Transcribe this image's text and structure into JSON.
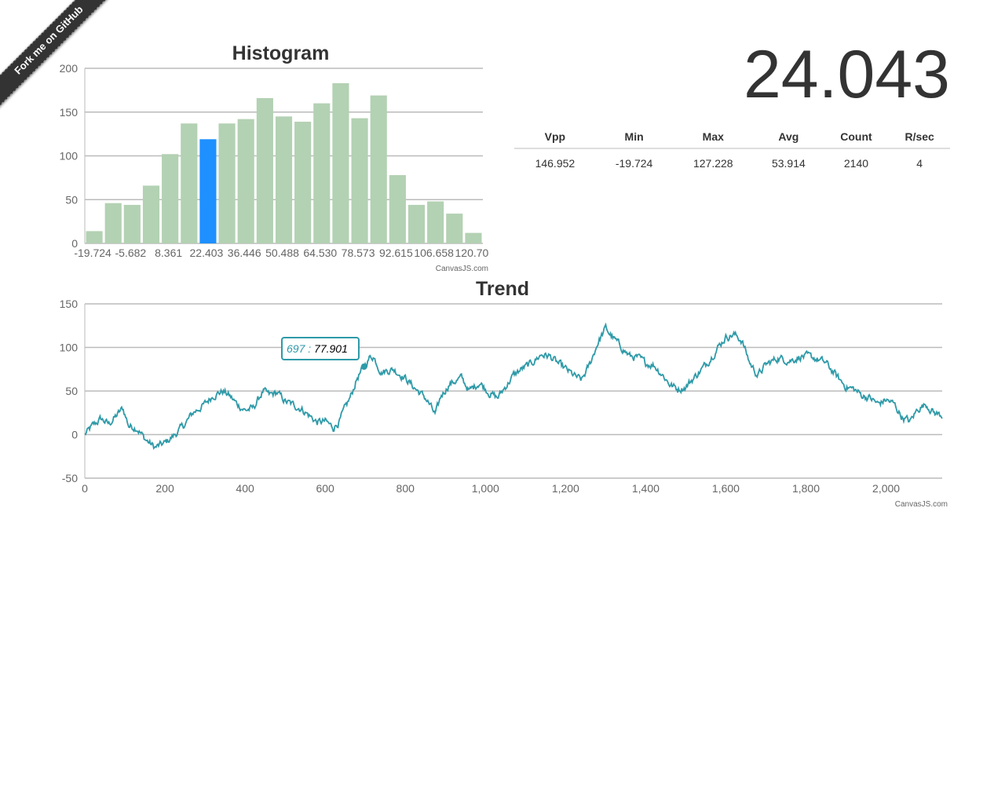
{
  "ribbon": {
    "label": "Fork me on GitHub"
  },
  "current_value": "24.043",
  "stats": {
    "headers": [
      "Vpp",
      "Min",
      "Max",
      "Avg",
      "Count",
      "R/sec"
    ],
    "values": [
      "146.952",
      "-19.724",
      "127.228",
      "53.914",
      "2140",
      "4"
    ]
  },
  "tooltip": {
    "x_label": "697 :",
    "y_value": "77.901"
  },
  "colors": {
    "bar": "#b3d1b3",
    "bar_highlight": "#1e90ff",
    "line": "#2e9aa8",
    "grid": "#bbbbbb"
  },
  "chart_data": [
    {
      "type": "bar",
      "title": "Histogram",
      "credit": "CanvasJS.com",
      "ylim": [
        0,
        200
      ],
      "yticks": [
        0,
        50,
        100,
        150,
        200
      ],
      "xtick_labels": [
        "-19.724",
        "-5.682",
        "8.361",
        "22.403",
        "36.446",
        "50.488",
        "64.530",
        "78.573",
        "92.615",
        "106.658",
        "120.70"
      ],
      "values": [
        14,
        46,
        44,
        66,
        102,
        137,
        119,
        137,
        142,
        166,
        145,
        139,
        160,
        183,
        143,
        169,
        78,
        44,
        48,
        34,
        12
      ],
      "highlight_index": 6,
      "grid": true
    },
    {
      "type": "line",
      "title": "Trend",
      "credit": "CanvasJS.com",
      "xlim": [
        0,
        2140
      ],
      "ylim": [
        -50,
        150
      ],
      "xticks": [
        0,
        200,
        400,
        600,
        800,
        1000,
        1200,
        1400,
        1600,
        1800,
        2000
      ],
      "xtick_labels": [
        "0",
        "200",
        "400",
        "600",
        "800",
        "1,000",
        "1,200",
        "1,400",
        "1,600",
        "1,800",
        "2,000"
      ],
      "yticks": [
        -50,
        0,
        50,
        100,
        150
      ],
      "highlight_point": [
        697,
        77.901
      ],
      "grid": true,
      "anchors": [
        [
          0,
          0
        ],
        [
          20,
          10
        ],
        [
          40,
          18
        ],
        [
          60,
          12
        ],
        [
          80,
          22
        ],
        [
          95,
          30
        ],
        [
          110,
          10
        ],
        [
          130,
          8
        ],
        [
          150,
          -5
        ],
        [
          175,
          -15
        ],
        [
          200,
          -10
        ],
        [
          225,
          0
        ],
        [
          250,
          12
        ],
        [
          270,
          25
        ],
        [
          300,
          35
        ],
        [
          320,
          45
        ],
        [
          345,
          50
        ],
        [
          360,
          45
        ],
        [
          380,
          35
        ],
        [
          400,
          28
        ],
        [
          420,
          30
        ],
        [
          445,
          50
        ],
        [
          460,
          45
        ],
        [
          480,
          48
        ],
        [
          500,
          38
        ],
        [
          540,
          30
        ],
        [
          560,
          22
        ],
        [
          580,
          14
        ],
        [
          600,
          15
        ],
        [
          620,
          8
        ],
        [
          635,
          15
        ],
        [
          650,
          30
        ],
        [
          665,
          45
        ],
        [
          680,
          65
        ],
        [
          697,
          77.9
        ],
        [
          710,
          88
        ],
        [
          720,
          90
        ],
        [
          740,
          72
        ],
        [
          770,
          75
        ],
        [
          800,
          65
        ],
        [
          820,
          55
        ],
        [
          850,
          42
        ],
        [
          860,
          35
        ],
        [
          875,
          22
        ],
        [
          890,
          45
        ],
        [
          910,
          58
        ],
        [
          940,
          65
        ],
        [
          960,
          50
        ],
        [
          985,
          60
        ],
        [
          1010,
          48
        ],
        [
          1030,
          42
        ],
        [
          1050,
          55
        ],
        [
          1070,
          68
        ],
        [
          1090,
          75
        ],
        [
          1110,
          80
        ],
        [
          1140,
          92
        ],
        [
          1160,
          90
        ],
        [
          1180,
          82
        ],
        [
          1200,
          75
        ],
        [
          1220,
          68
        ],
        [
          1240,
          62
        ],
        [
          1260,
          80
        ],
        [
          1280,
          105
        ],
        [
          1300,
          122
        ],
        [
          1320,
          110
        ],
        [
          1340,
          100
        ],
        [
          1360,
          90
        ],
        [
          1380,
          88
        ],
        [
          1400,
          82
        ],
        [
          1420,
          80
        ],
        [
          1440,
          70
        ],
        [
          1460,
          58
        ],
        [
          1480,
          52
        ],
        [
          1500,
          55
        ],
        [
          1520,
          65
        ],
        [
          1550,
          80
        ],
        [
          1580,
          100
        ],
        [
          1600,
          112
        ],
        [
          1620,
          115
        ],
        [
          1640,
          108
        ],
        [
          1660,
          82
        ],
        [
          1680,
          68
        ],
        [
          1700,
          80
        ],
        [
          1730,
          88
        ],
        [
          1760,
          85
        ],
        [
          1790,
          90
        ],
        [
          1820,
          88
        ],
        [
          1850,
          82
        ],
        [
          1880,
          65
        ],
        [
          1900,
          55
        ],
        [
          1920,
          52
        ],
        [
          1940,
          45
        ],
        [
          1960,
          42
        ],
        [
          1980,
          35
        ],
        [
          2000,
          40
        ],
        [
          2020,
          35
        ],
        [
          2040,
          20
        ],
        [
          2060,
          15
        ],
        [
          2080,
          30
        ],
        [
          2100,
          35
        ],
        [
          2120,
          25
        ],
        [
          2140,
          22
        ]
      ]
    }
  ]
}
